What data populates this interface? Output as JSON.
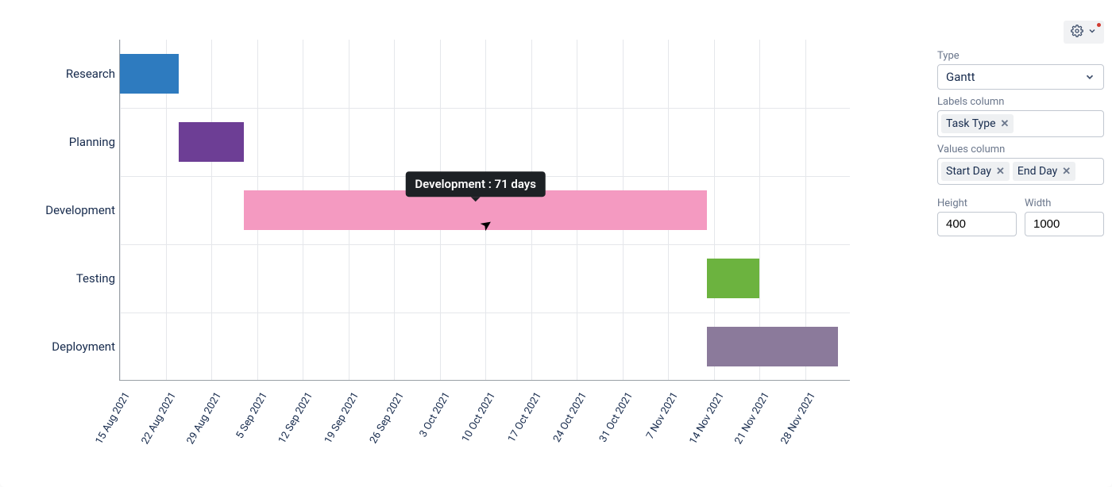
{
  "chart_data": {
    "type": "bar",
    "orientation": "horizontal_gantt",
    "categories": [
      "Research",
      "Planning",
      "Development",
      "Testing",
      "Deployment"
    ],
    "x_ticks": [
      "15 Aug 2021",
      "22 Aug 2021",
      "29 Aug 2021",
      "5 Sep 2021",
      "12 Sep 2021",
      "19 Sep 2021",
      "26 Sep 2021",
      "3 Oct 2021",
      "10 Oct 2021",
      "17 Oct 2021",
      "24 Oct 2021",
      "31 Oct 2021",
      "7 Nov 2021",
      "14 Nov 2021",
      "21 Nov 2021",
      "28 Nov 2021"
    ],
    "series": [
      {
        "name": "Research",
        "start": "15 Aug 2021",
        "end": "24 Aug 2021",
        "color": "#2e7bbf"
      },
      {
        "name": "Planning",
        "start": "24 Aug 2021",
        "end": "3 Sep 2021",
        "color": "#6d3e95"
      },
      {
        "name": "Development",
        "start": "3 Sep 2021",
        "end": "13 Nov 2021",
        "color": "#f49ac1",
        "duration_days": 71
      },
      {
        "name": "Testing",
        "start": "13 Nov 2021",
        "end": "21 Nov 2021",
        "color": "#6cb33f"
      },
      {
        "name": "Deployment",
        "start": "13 Nov 2021",
        "end": "3 Dec 2021",
        "color": "#8b7a9b"
      }
    ],
    "x_range_days": 112,
    "x_start": "15 Aug 2021",
    "tooltip": {
      "task": "Development",
      "text": "Development : 71 days"
    }
  },
  "panel": {
    "type_label": "Type",
    "type_value": "Gantt",
    "labels_column_label": "Labels column",
    "labels_column_tag": "Task Type",
    "values_column_label": "Values column",
    "values_tags": [
      "Start Day",
      "End Day"
    ],
    "height_label": "Height",
    "height_value": "400",
    "width_label": "Width",
    "width_value": "1000"
  }
}
